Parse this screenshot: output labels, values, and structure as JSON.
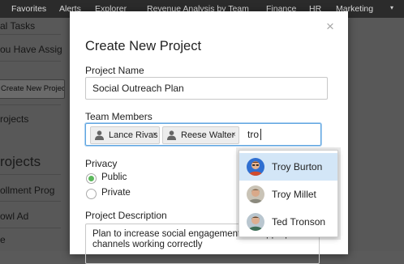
{
  "nav": {
    "items": [
      "Favorites",
      "Alerts",
      "Explorer",
      "Revenue Analysis by Team",
      "Finance",
      "HR",
      "Marketing"
    ],
    "caret": "▾"
  },
  "background": {
    "row_tasks": "al Tasks",
    "row_assigned": "ou Have Assig",
    "new_project_button": "Create New Projec",
    "row_projects": "rojects",
    "heading_projects": "rojects",
    "row_enrollment": "ollment Prog",
    "row_bowl": "owl Ad",
    "row_e": "e"
  },
  "modal": {
    "title": "Create New Project",
    "close_glyph": "×",
    "project_name_label": "Project Name",
    "project_name_value": "Social Outreach Plan",
    "team_members_label": "Team Members",
    "members": [
      {
        "name": "Lance Rivas",
        "remove": "×"
      },
      {
        "name": "Reese Walter",
        "remove": "×"
      }
    ],
    "members_query": "tro",
    "privacy_label": "Privacy",
    "privacy_options": [
      {
        "label": "Public",
        "checked": true
      },
      {
        "label": "Private",
        "checked": false
      }
    ],
    "description_label": "Project Description",
    "description_value": "Plan to increase social engagement and appropriate channels working correctly"
  },
  "suggestions": [
    {
      "name": "Troy Burton",
      "highlighted": true
    },
    {
      "name": "Troy Millet",
      "highlighted": false
    },
    {
      "name": "Ted Tronson",
      "highlighted": false
    }
  ],
  "colors": {
    "accent_focus": "#5ea5e0",
    "radio_checked": "#5cb85c",
    "highlight_row": "#d3e6f7",
    "nav_bg": "#2b2b2b"
  }
}
